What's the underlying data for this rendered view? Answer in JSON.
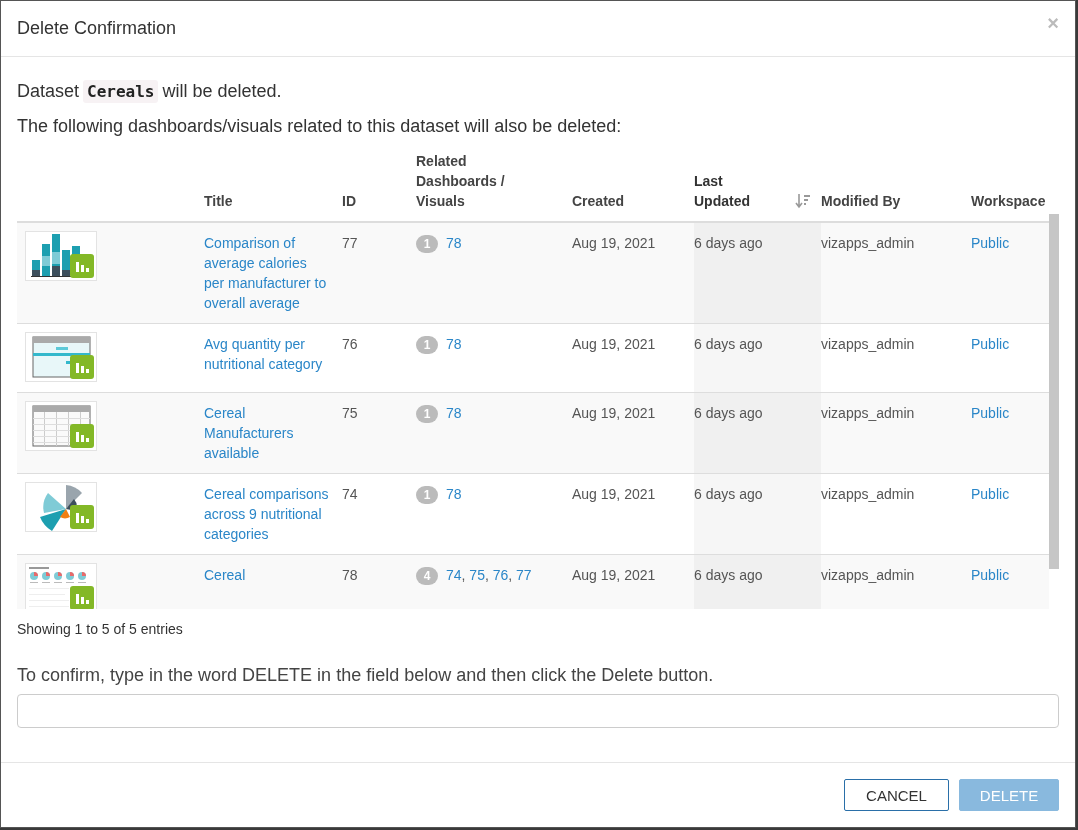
{
  "dialog": {
    "title": "Delete Confirmation",
    "close": "×"
  },
  "message": {
    "prefix": "Dataset",
    "dataset": "Cereals",
    "suffix": "will be deleted."
  },
  "note": "The following dashboards/visuals related to this dataset will also be deleted:",
  "table": {
    "separator": ",",
    "columns": [
      {
        "label": "Title",
        "sorted": false
      },
      {
        "label": "ID",
        "sorted": false
      },
      {
        "label": "Related Dashboards / Visuals",
        "sorted": false
      },
      {
        "label": "Created",
        "sorted": false
      },
      {
        "label": "Last Updated",
        "sorted": true
      },
      {
        "label": "Modified By",
        "sorted": false
      },
      {
        "label": "Workspace",
        "sorted": false
      }
    ],
    "rows": [
      {
        "kind": "bar",
        "title": "Comparison of average calories per manufacturer to overall average",
        "id": "77",
        "related_count": "1",
        "related": [
          "78"
        ],
        "created": "Aug 19, 2021",
        "updated": "6 days ago",
        "modified_by": "vizapps_admin",
        "workspace": "Public"
      },
      {
        "kind": "heatmap",
        "title": "Avg quantity per nutritional category",
        "id": "76",
        "related_count": "1",
        "related": [
          "78"
        ],
        "created": "Aug 19, 2021",
        "updated": "6 days ago",
        "modified_by": "vizapps_admin",
        "workspace": "Public"
      },
      {
        "kind": "table",
        "title": "Cereal Manufacturers available",
        "id": "75",
        "related_count": "1",
        "related": [
          "78"
        ],
        "created": "Aug 19, 2021",
        "updated": "6 days ago",
        "modified_by": "vizapps_admin",
        "workspace": "Public"
      },
      {
        "kind": "radial",
        "title": "Cereal comparisons across 9 nutritional categories",
        "id": "74",
        "related_count": "1",
        "related": [
          "78"
        ],
        "created": "Aug 19, 2021",
        "updated": "6 days ago",
        "modified_by": "vizapps_admin",
        "workspace": "Public"
      },
      {
        "kind": "dashboard",
        "title": "Cereal",
        "id": "78",
        "related_count": "4",
        "related": [
          "74",
          "75",
          "76",
          "77"
        ],
        "created": "Aug 19, 2021",
        "updated": "6 days ago",
        "modified_by": "vizapps_admin",
        "workspace": "Public"
      }
    ]
  },
  "entries": "Showing 1 to 5 of 5 entries",
  "confirm": {
    "instruction": "To confirm, type in the word DELETE in the field below and then click the Delete button."
  },
  "buttons": [
    {
      "kind": "secondary",
      "label": "CANCEL",
      "disabled": false
    },
    {
      "kind": "primary",
      "label": "DELETE",
      "disabled": true
    }
  ]
}
